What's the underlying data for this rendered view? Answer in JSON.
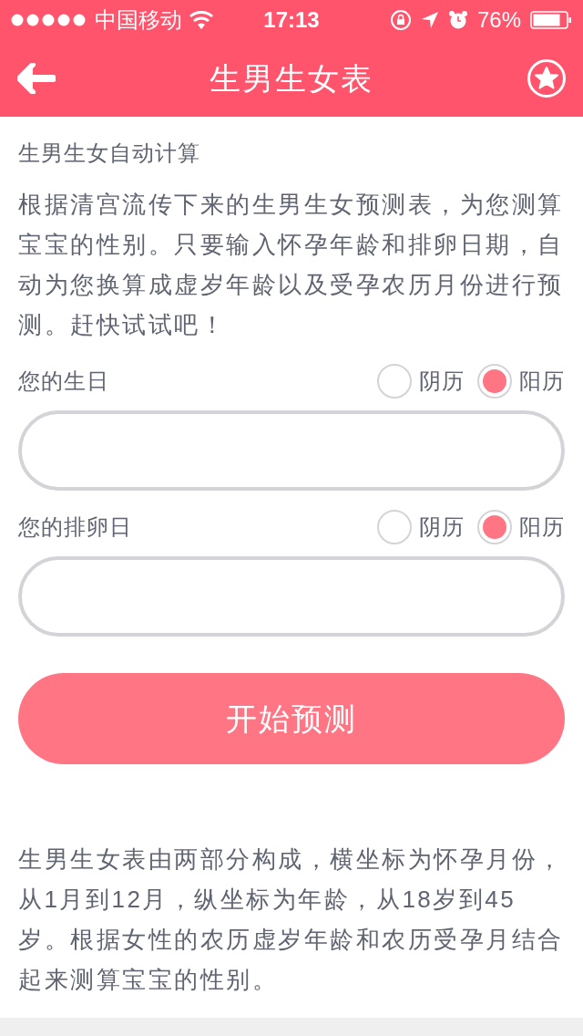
{
  "status_bar": {
    "carrier": "中国移动",
    "time": "17:13",
    "battery": "76%"
  },
  "nav": {
    "title": "生男生女表"
  },
  "section_title": "生男生女自动计算",
  "intro": "根据清宫流传下来的生男生女预测表，为您测算宝宝的性别。只要输入怀孕年龄和排卵日期，自动为您换算成虚岁年龄以及受孕农历月份进行预测。赶快试试吧！",
  "fields": [
    {
      "label": "您的生日",
      "options": [
        {
          "label": "阴历",
          "selected": false
        },
        {
          "label": "阳历",
          "selected": true
        }
      ]
    },
    {
      "label": "您的排卵日",
      "options": [
        {
          "label": "阴历",
          "selected": false
        },
        {
          "label": "阳历",
          "selected": true
        }
      ]
    }
  ],
  "submit": "开始预测",
  "footer": "生男生女表由两部分构成，横坐标为怀孕月份，从1月到12月，纵坐标为年龄，从18岁到45岁。根据女性的农历虚岁年龄和农历受孕月结合起来测算宝宝的性别。"
}
